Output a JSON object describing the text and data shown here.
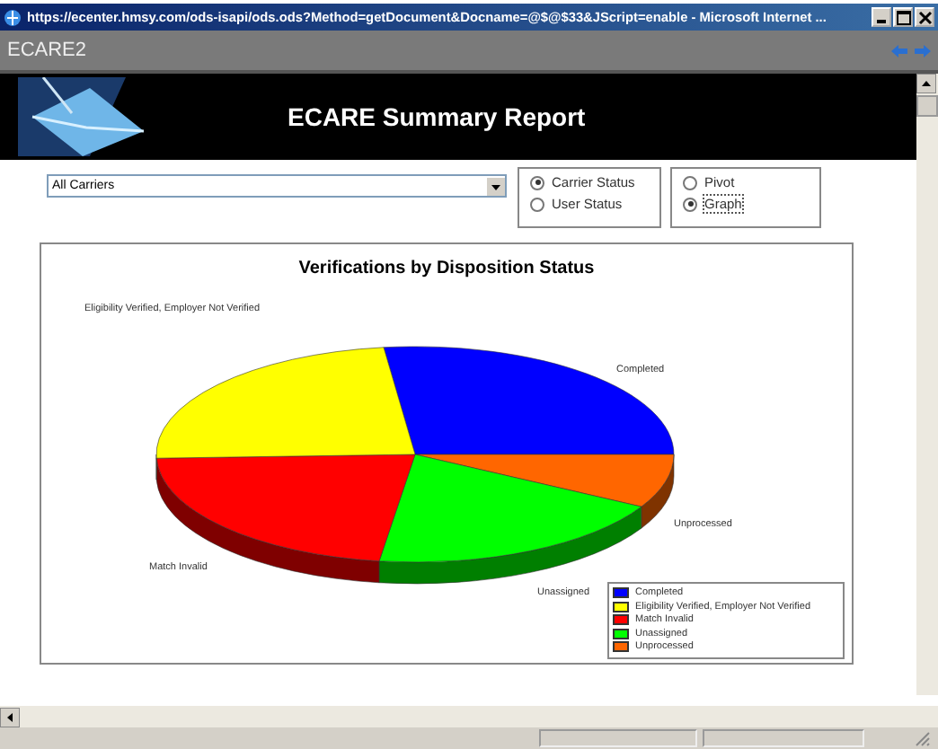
{
  "window": {
    "title": "https://ecenter.hmsy.com/ods-isapi/ods.ods?Method=getDocument&Docname=@$@$33&JScript=enable - Microsoft Internet ..."
  },
  "app_bar": {
    "title": "ECARE2"
  },
  "banner": {
    "title": "ECARE Summary Report"
  },
  "carrier_select": {
    "value": "All Carriers"
  },
  "status_options": [
    {
      "label": "Carrier Status",
      "selected": true
    },
    {
      "label": "User Status",
      "selected": false
    }
  ],
  "view_options": [
    {
      "label": "Pivot",
      "selected": false
    },
    {
      "label": "Graph",
      "selected": true
    }
  ],
  "chart": {
    "title": "Verifications by Disposition Status",
    "slices": [
      {
        "label": "Completed",
        "color": "#0000ff"
      },
      {
        "label": "Unprocessed",
        "color": "#ff6600"
      },
      {
        "label": "Unassigned",
        "color": "#00ff00"
      },
      {
        "label": "Match Invalid",
        "color": "#ff0000"
      },
      {
        "label": "Eligibility Verified, Employer Not Verified",
        "color": "#ffff00"
      }
    ],
    "legend": [
      {
        "label": "Completed",
        "color": "#0000ff"
      },
      {
        "label": "Eligibility Verified, Employer Not Verified",
        "color": "#ffff00"
      },
      {
        "label": "Match Invalid",
        "color": "#ff0000"
      },
      {
        "label": "Unassigned",
        "color": "#00ff00"
      },
      {
        "label": "Unprocessed",
        "color": "#ff6600"
      }
    ]
  }
}
